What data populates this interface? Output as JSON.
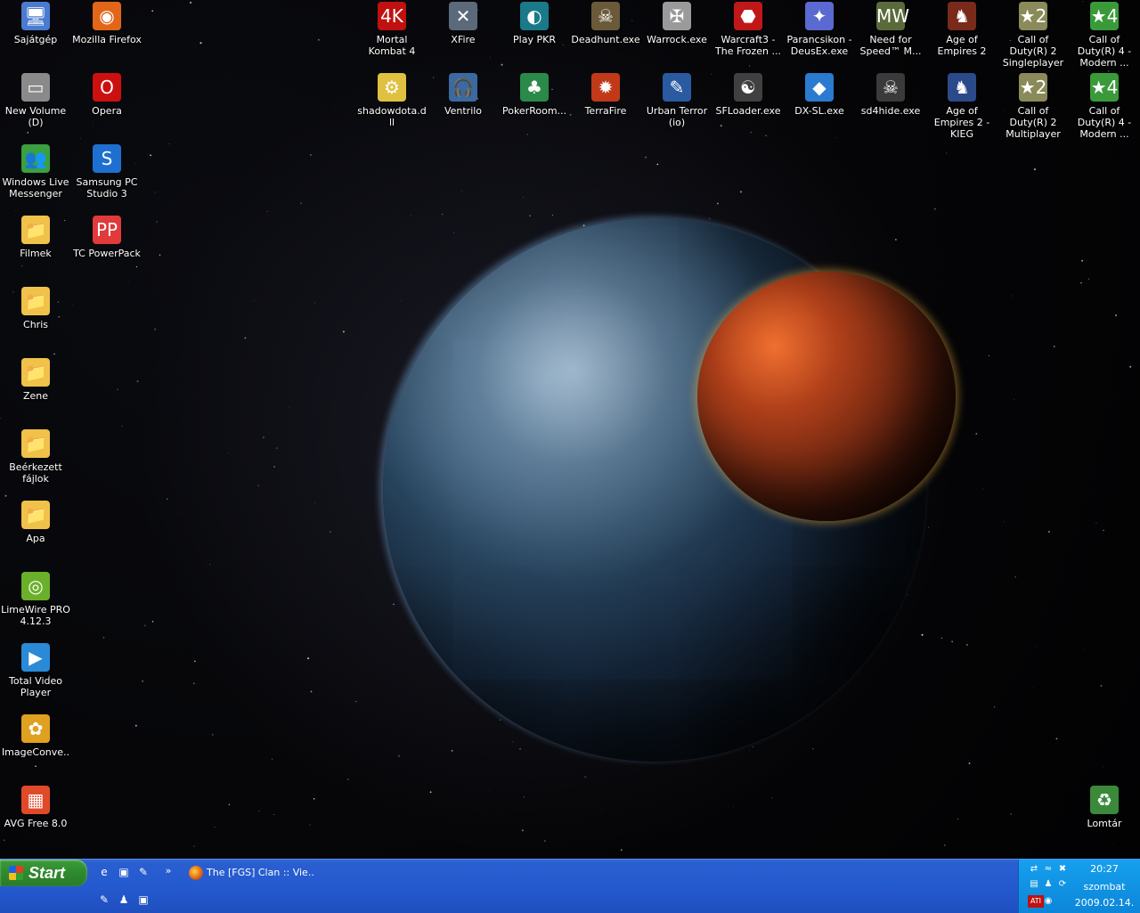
{
  "desktop": {
    "icons": [
      {
        "label": "Sajátgép",
        "icon": "my-computer-icon",
        "glyph": "🖥",
        "color": "#4a7bd0"
      },
      {
        "label": "Mozilla Firefox",
        "icon": "firefox-icon",
        "glyph": "◉",
        "color": "#e2661a"
      },
      {
        "label": "New Volume (D)",
        "icon": "drive-icon",
        "glyph": "▭",
        "color": "#8a8a8a"
      },
      {
        "label": "Opera",
        "icon": "opera-icon",
        "glyph": "O",
        "color": "#cc1010"
      },
      {
        "label": "Windows Live Messenger",
        "icon": "messenger-icon",
        "glyph": "👥",
        "color": "#3aa040"
      },
      {
        "label": "Samsung PC Studio 3",
        "icon": "samsung-icon",
        "glyph": "S",
        "color": "#1e70d0"
      },
      {
        "label": "Filmek",
        "icon": "folder-icon",
        "glyph": "📁",
        "color": "#f0c24a"
      },
      {
        "label": "TC PowerPack",
        "icon": "powerpack-icon",
        "glyph": "PP",
        "color": "#e03a3a"
      },
      {
        "label": "Chris",
        "icon": "folder-icon",
        "glyph": "📁",
        "color": "#f0c24a"
      },
      {
        "label": "Zene",
        "icon": "folder-icon",
        "glyph": "📁",
        "color": "#f0c24a"
      },
      {
        "label": "Beérkezett fájlok",
        "icon": "folder-icon",
        "glyph": "📁",
        "color": "#f0c24a"
      },
      {
        "label": "Apa",
        "icon": "folder-icon",
        "glyph": "📁",
        "color": "#f0c24a"
      },
      {
        "label": "LimeWire PRO 4.12.3",
        "icon": "limewire-icon",
        "glyph": "◎",
        "color": "#6ab02a"
      },
      {
        "label": "Total Video Player",
        "icon": "video-player-icon",
        "glyph": "▶",
        "color": "#2a8ad8"
      },
      {
        "label": "ImageConve...",
        "icon": "image-converter-icon",
        "glyph": "✿",
        "color": "#e0a020"
      },
      {
        "label": "AVG Free 8.0",
        "icon": "avg-icon",
        "glyph": "▦",
        "color": "#e04a2a"
      },
      {
        "label": "Mortal Kombat 4",
        "icon": "mk4-icon",
        "glyph": "4K",
        "color": "#c01010"
      },
      {
        "label": "XFire",
        "icon": "xfire-icon",
        "glyph": "✕",
        "color": "#5a6a7a"
      },
      {
        "label": "Play PKR",
        "icon": "pkr-icon",
        "glyph": "◐",
        "color": "#1a7a8a"
      },
      {
        "label": "Deadhunt.exe",
        "icon": "deadhunt-icon",
        "glyph": "☠",
        "color": "#6a5a3a"
      },
      {
        "label": "Warrock.exe",
        "icon": "warrock-icon",
        "glyph": "✠",
        "color": "#9a9a9a"
      },
      {
        "label": "Warcraft3 - The Frozen ...",
        "icon": "warcraft-icon",
        "glyph": "⬣",
        "color": "#c01818"
      },
      {
        "label": "Parancsikon - DeusEx.exe",
        "icon": "deusex-icon",
        "glyph": "✦",
        "color": "#5a6ad0"
      },
      {
        "label": "Need for Speed™ M...",
        "icon": "nfs-icon",
        "glyph": "MW",
        "color": "#5a6a3a"
      },
      {
        "label": "Age of Empires 2",
        "icon": "aoe2-icon",
        "glyph": "♞",
        "color": "#7a2a1a"
      },
      {
        "label": "Call of Duty(R) 2 Singleplayer",
        "icon": "cod2-icon",
        "glyph": "★2",
        "color": "#8a8a5a"
      },
      {
        "label": "Call of Duty(R) 4 - Modern ...",
        "icon": "cod4-icon",
        "glyph": "★4",
        "color": "#3a9a3a"
      },
      {
        "label": "shadowdota.dll",
        "icon": "dll-icon",
        "glyph": "⚙",
        "color": "#e0c040"
      },
      {
        "label": "Ventrilo",
        "icon": "ventrilo-icon",
        "glyph": "🎧",
        "color": "#3a6aa0"
      },
      {
        "label": "PokerRoom...",
        "icon": "pokerroom-icon",
        "glyph": "♣",
        "color": "#2a8a4a"
      },
      {
        "label": "TerraFire",
        "icon": "terrafire-icon",
        "glyph": "✹",
        "color": "#c03a1a"
      },
      {
        "label": "Urban Terror (io)",
        "icon": "urbanterror-icon",
        "glyph": "✎",
        "color": "#2a5aa0"
      },
      {
        "label": "SFLoader.exe",
        "icon": "sfloader-icon",
        "glyph": "☯",
        "color": "#404040"
      },
      {
        "label": "DX-SL.exe",
        "icon": "dxsl-icon",
        "glyph": "◆",
        "color": "#2a7ad0"
      },
      {
        "label": "sd4hide.exe",
        "icon": "sd4hide-icon",
        "glyph": "☠",
        "color": "#3a3a3a"
      },
      {
        "label": "Age of Empires 2 - KIEG",
        "icon": "aoe2-kieg-icon",
        "glyph": "♞",
        "color": "#2a4a8a"
      },
      {
        "label": "Call of Duty(R) 2 Multiplayer",
        "icon": "cod2-mp-icon",
        "glyph": "★2",
        "color": "#8a8a5a"
      },
      {
        "label": "Call of Duty(R) 4 - Modern ...",
        "icon": "cod4-mp-icon",
        "glyph": "★4",
        "color": "#3a9a3a"
      },
      {
        "label": "Lomtár",
        "icon": "recycle-bin-icon",
        "glyph": "♻",
        "color": "#3a8a3a"
      }
    ]
  },
  "taskbar": {
    "start_label": "Start",
    "quick_launch": [
      {
        "icon": "ie-icon",
        "glyph": "e"
      },
      {
        "icon": "folder-icon",
        "glyph": "▣"
      },
      {
        "icon": "brush-icon",
        "glyph": "✎"
      },
      {
        "icon": "notepad-icon",
        "glyph": "✎"
      },
      {
        "icon": "msn-icon",
        "glyph": "♟"
      },
      {
        "icon": "folder-icon",
        "glyph": "▣"
      }
    ],
    "chevron": "»",
    "window_title": "The [FGS] Clan :: Vie...",
    "tray_icons": [
      {
        "icon": "network-icon",
        "glyph": "⇄"
      },
      {
        "icon": "wifi-icon",
        "glyph": "≈"
      },
      {
        "icon": "antivirus-icon",
        "glyph": "✖"
      },
      {
        "icon": "printer-icon",
        "glyph": "▤"
      },
      {
        "icon": "messenger-tray-icon",
        "glyph": "♟"
      },
      {
        "icon": "sync-icon",
        "glyph": "⟳"
      },
      {
        "icon": "ati-icon",
        "glyph": "ATI"
      },
      {
        "icon": "speaker-icon",
        "glyph": "◉"
      }
    ],
    "clock": {
      "time": "20:27",
      "day": "szombat",
      "date": "2009.02.14."
    }
  }
}
